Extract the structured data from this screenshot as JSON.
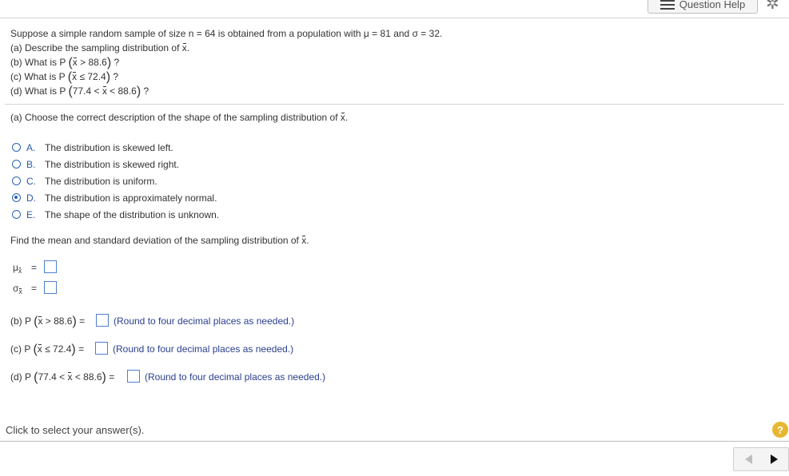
{
  "header": {
    "question_help_label": "Question Help"
  },
  "problem": {
    "intro_a": "Suppose a simple random sample of size n = 64 is obtained from a population with ",
    "mu_sym": "μ",
    "intro_b": " = 81 and ",
    "sigma_sym": "σ",
    "intro_c": " = 32.",
    "a_text": "(a) Describe the sampling distribution of ",
    "b_pre": "(b) What is P ",
    "b_expr": " > 88.6",
    "c_pre": "(c) What is P ",
    "c_expr": " ≤ 72.4",
    "d_pre": "(d) What is P ",
    "d_expr_a": "77.4 < ",
    "d_expr_b": " < 88.6",
    "qmark": "?",
    "xbar": "x"
  },
  "part_a": {
    "prompt": "(a) Choose the correct description of the shape of the sampling distribution of ",
    "selected_option": "D",
    "options": [
      {
        "letter": "A.",
        "text": "The distribution is skewed left."
      },
      {
        "letter": "B.",
        "text": "The distribution is skewed right."
      },
      {
        "letter": "C.",
        "text": "The distribution is uniform."
      },
      {
        "letter": "D.",
        "text": "The distribution is approximately normal."
      },
      {
        "letter": "E.",
        "text": "The shape of the distribution is unknown."
      }
    ]
  },
  "mean_sd": {
    "prompt": "Find the mean and standard deviation of the sampling distribution of ",
    "mu_label": "μ",
    "sigma_label": "σ",
    "sub": "x",
    "equals": "=",
    "mu_value": "",
    "sigma_value": ""
  },
  "parts": {
    "b_label": "(b) P ",
    "b_expr": " > 88.6",
    "c_label": "(c) P ",
    "c_expr": " ≤ 72.4",
    "d_label": "(d) P ",
    "d_expr_a": "77.4 < ",
    "d_expr_b": " < 88.6",
    "equals": "=",
    "round_hint": "(Round to four decimal places as needed.)",
    "b_value": "",
    "c_value": "",
    "d_value": ""
  },
  "footer": {
    "status": "Click to select your answer(s).",
    "help_symbol": "?"
  },
  "colors": {
    "accent": "#2c64b8",
    "hint": "#2a3f8f",
    "help": "#e7b733"
  },
  "icons": {
    "menu": "list-icon",
    "settings": "gear-icon",
    "help": "help-icon",
    "prev": "prev-arrow-icon",
    "next": "next-arrow-icon"
  }
}
